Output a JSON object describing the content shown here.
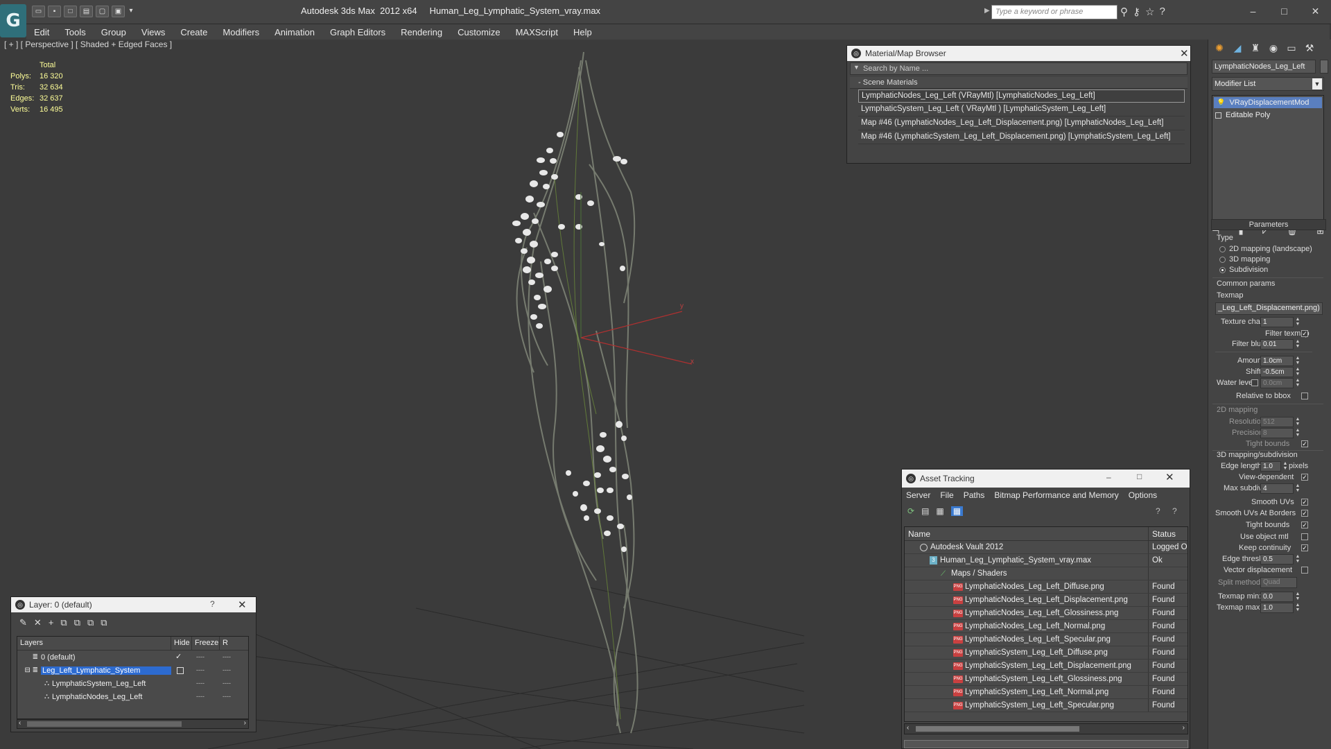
{
  "window": {
    "title": "Autodesk 3ds Max  2012 x64     Human_Leg_Lymphatic_System_vray.max",
    "search_placeholder": "Type a keyword or phrase",
    "app_logo_glyph": "G"
  },
  "menu": [
    "Edit",
    "Tools",
    "Group",
    "Views",
    "Create",
    "Modifiers",
    "Animation",
    "Graph Editors",
    "Rendering",
    "Customize",
    "MAXScript",
    "Help"
  ],
  "viewport": {
    "label": "[ + ] [ Perspective ] [ Shaded + Edged Faces ]",
    "stats_header": "Total",
    "stats": [
      {
        "label": "Polys:",
        "value": "16 320"
      },
      {
        "label": "Tris:",
        "value": "32 634"
      },
      {
        "label": "Edges:",
        "value": "32 637"
      },
      {
        "label": "Verts:",
        "value": "16 495"
      }
    ],
    "axis_x": "x",
    "axis_y": "y"
  },
  "material_browser": {
    "title": "Material/Map Browser",
    "search_placeholder": "Search by Name ...",
    "section": "Scene Materials",
    "items": [
      "LymphaticNodes_Leg_Left (VRayMtl) [LymphaticNodes_Leg_Left]",
      "LymphaticSystem_Leg_Left ( VRayMtl ) [LymphaticSystem_Leg_Left]",
      "Map #46 (LymphaticNodes_Leg_Left_Displacement.png) [LymphaticNodes_Leg_Left]",
      "Map #46 (LymphaticSystem_Leg_Left_Displacement.png) [LymphaticSystem_Leg_Left]"
    ]
  },
  "command_panel": {
    "object_name": "LymphaticNodes_Leg_Left",
    "modifier_list": "Modifier List",
    "stack": [
      "VRayDisplacementMod",
      "Editable Poly"
    ],
    "rollout_parameters": "Parameters",
    "type_label": "Type",
    "type_options": [
      "2D mapping (landscape)",
      "3D mapping",
      "Subdivision"
    ],
    "common_params": "Common params",
    "texmap_label": "Texmap",
    "texmap_value": "_Leg_Left_Displacement.png)",
    "texture_chan_label": "Texture chan",
    "texture_chan_value": "1",
    "filter_texmap_label": "Filter texmap",
    "filter_blur_label": "Filter blur",
    "filter_blur_value": "0.01",
    "amount_label": "Amount",
    "amount_value": "1.0cm",
    "shift_label": "Shift",
    "shift_value": "-0.5cm",
    "water_level_label": "Water level",
    "water_level_value": "0.0cm",
    "relative_bbox_label": "Relative to bbox",
    "mapping_2d": "2D mapping",
    "resolution_label": "Resolution",
    "resolution_value": "512",
    "precision_label": "Precision",
    "precision_value": "8",
    "tight_bounds_label": "Tight bounds",
    "mapping_3d": "3D mapping/subdivision",
    "edge_length_label": "Edge length",
    "edge_length_value": "1.0",
    "pixels_label": "pixels",
    "view_dependent_label": "View-dependent",
    "max_subdivs_label": "Max subdivs",
    "max_subdivs_value": "4",
    "smooth_uvs_label": "Smooth UVs",
    "smooth_uvs_borders_label": "Smooth UVs At Borders",
    "tight_bounds2_label": "Tight bounds",
    "use_object_mtl_label": "Use object mtl",
    "keep_continuity_label": "Keep continuity",
    "edge_thresh_label": "Edge thresh",
    "edge_thresh_value": "0.5",
    "vector_disp_label": "Vector displacement",
    "split_method_label": "Split method:",
    "split_method_value": "Quad",
    "texmap_min_label": "Texmap min:",
    "texmap_min_value": "0.0",
    "texmap_max_label": "Texmap max:",
    "texmap_max_value": "1.0"
  },
  "layers": {
    "title": "Layer: 0 (default)",
    "help": "?",
    "col_layers": "Layers",
    "col_hide": "Hide",
    "col_freeze": "Freeze",
    "col_r": "R",
    "rows": [
      {
        "name": "0 (default)"
      },
      {
        "name": "Leg_Left_Lymphatic_System"
      },
      {
        "name": "LymphaticSystem_Leg_Left"
      },
      {
        "name": "LymphaticNodes_Leg_Left"
      }
    ],
    "dash": "----"
  },
  "asset_tracking": {
    "title": "Asset Tracking",
    "menu": [
      "Server",
      "File",
      "Paths",
      "Bitmap Performance and Memory",
      "Options"
    ],
    "col_name": "Name",
    "col_status": "Status",
    "rows": [
      {
        "name": "Autodesk Vault 2012",
        "status": "Logged O"
      },
      {
        "name": "Human_Leg_Lymphatic_System_vray.max",
        "status": "Ok"
      },
      {
        "name": "Maps / Shaders",
        "status": ""
      },
      {
        "name": "LymphaticNodes_Leg_Left_Diffuse.png",
        "status": "Found"
      },
      {
        "name": "LymphaticNodes_Leg_Left_Displacement.png",
        "status": "Found"
      },
      {
        "name": "LymphaticNodes_Leg_Left_Glossiness.png",
        "status": "Found"
      },
      {
        "name": "LymphaticNodes_Leg_Left_Normal.png",
        "status": "Found"
      },
      {
        "name": "LymphaticNodes_Leg_Left_Specular.png",
        "status": "Found"
      },
      {
        "name": "LymphaticSystem_Leg_Left_Diffuse.png",
        "status": "Found"
      },
      {
        "name": "LymphaticSystem_Leg_Left_Displacement.png",
        "status": "Found"
      },
      {
        "name": "LymphaticSystem_Leg_Left_Glossiness.png",
        "status": "Found"
      },
      {
        "name": "LymphaticSystem_Leg_Left_Normal.png",
        "status": "Found"
      },
      {
        "name": "LymphaticSystem_Leg_Left_Specular.png",
        "status": "Found"
      }
    ]
  }
}
